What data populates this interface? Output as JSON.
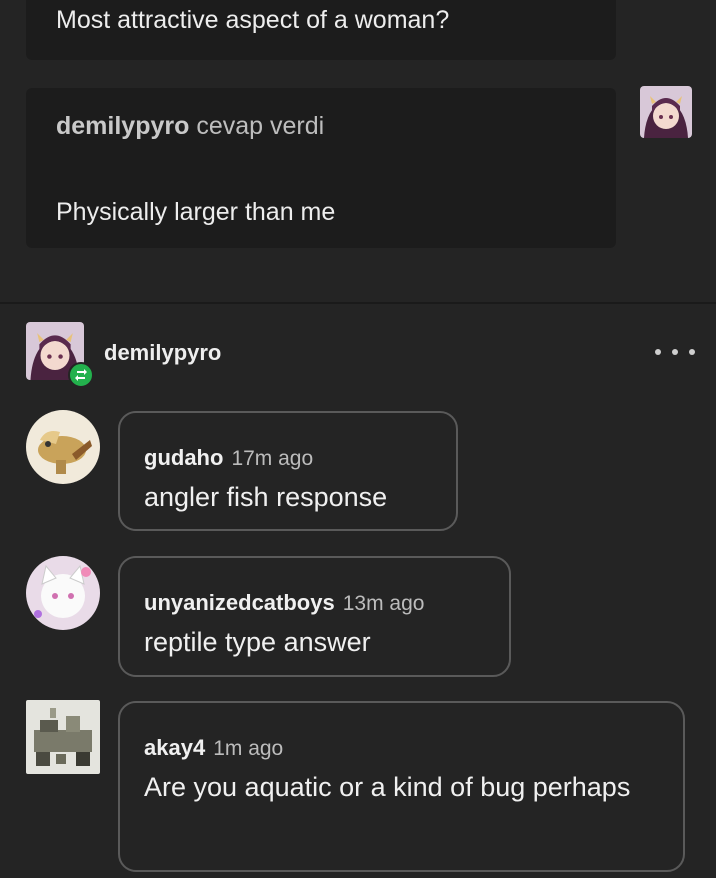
{
  "ask": {
    "question": "Most attractive aspect of a woman?"
  },
  "answer": {
    "username": "demilypyro",
    "action": "cevap verdi",
    "text": "Physically larger than me"
  },
  "post": {
    "username": "demilypyro",
    "more_icon": "more-horizontal-icon",
    "reblog_icon": "reblog-icon"
  },
  "replies": [
    {
      "username": "gudaho",
      "time": "17m ago",
      "text": "angler fish response"
    },
    {
      "username": "unyanizedcatboys",
      "time": "13m ago",
      "text": "reptile type answer"
    },
    {
      "username": "akay4",
      "time": "1m ago",
      "text": "Are you aquatic or a kind of bug perhaps"
    }
  ],
  "colors": {
    "background": "#242424",
    "card": "#1c1c1c",
    "reblog_green": "#23b14d",
    "bubble_border": "#5a5a5a"
  }
}
